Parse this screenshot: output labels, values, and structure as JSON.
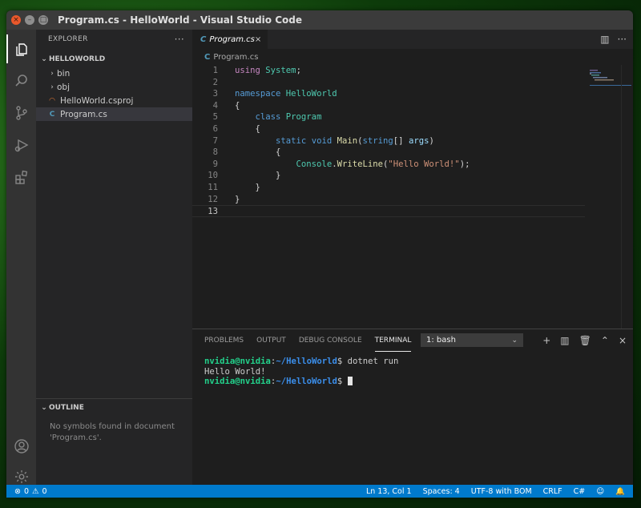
{
  "window": {
    "title": "Program.cs - HelloWorld - Visual Studio Code",
    "buttons": {
      "close": "×",
      "minimize": "–",
      "maximize": "□"
    }
  },
  "activity_bar": {
    "items": [
      "explorer-icon",
      "search-icon",
      "source-control-icon",
      "debug-icon",
      "extensions-icon"
    ],
    "bottom": [
      "account-icon",
      "settings-gear-icon"
    ]
  },
  "sidebar": {
    "header": "EXPLORER",
    "more": "···",
    "folder": "HELLOWORLD",
    "items": [
      {
        "label": "bin",
        "kind": "folder"
      },
      {
        "label": "obj",
        "kind": "folder"
      },
      {
        "label": "HelloWorld.csproj",
        "kind": "rss"
      },
      {
        "label": "Program.cs",
        "kind": "csharp"
      }
    ],
    "outline": {
      "title": "OUTLINE",
      "message_line1": "No symbols found in document",
      "message_line2": "'Program.cs'."
    }
  },
  "editor": {
    "tab_label": "Program.cs",
    "tab_close": "×",
    "breadcrumb": "Program.cs",
    "line_numbers": [
      "1",
      "2",
      "3",
      "4",
      "5",
      "6",
      "7",
      "8",
      "9",
      "10",
      "11",
      "12",
      "13"
    ],
    "code": {
      "l1_kw": "using",
      "l1_ns": "System",
      "l1_end": ";",
      "l3_kw": "namespace",
      "l3_name": "HelloWorld",
      "l4": "{",
      "l5_kw": "class",
      "l5_name": "Program",
      "l6": "{",
      "l7_static": "static",
      "l7_void": "void",
      "l7_method": "Main",
      "l7_open": "(",
      "l7_type": "string",
      "l7_brackets": "[] ",
      "l7_arg": "args",
      "l7_close": ")",
      "l8": "{",
      "l9_obj": "Console",
      "l9_dot": ".",
      "l9_method": "WriteLine",
      "l9_open": "(",
      "l9_str": "\"Hello World!\"",
      "l9_close": ");",
      "l10": "}",
      "l11": "}",
      "l12": "}"
    }
  },
  "panel": {
    "tabs": [
      "PROBLEMS",
      "OUTPUT",
      "DEBUG CONSOLE",
      "TERMINAL"
    ],
    "active_tab": "TERMINAL",
    "terminal_select": "1: bash",
    "terminal": {
      "user": "nvidia@nvidia",
      "colon": ":",
      "path": "~/HelloWorld",
      "dollar": "$",
      "command1": " dotnet run",
      "output": "Hello World!"
    }
  },
  "status_bar": {
    "errors": "0",
    "warnings": "0",
    "position": "Ln 13, Col 1",
    "spaces": "Spaces: 4",
    "encoding": "UTF-8 with BOM",
    "eol": "CRLF",
    "language": "C#"
  },
  "colors": {
    "accent": "#007acc",
    "keyword": "#c586c0",
    "keyword_blue": "#569cd6",
    "type": "#4ec9b0",
    "function": "#dcdcaa",
    "string": "#ce9178",
    "terminal_user": "#23d18b",
    "terminal_path": "#3b8eea"
  }
}
